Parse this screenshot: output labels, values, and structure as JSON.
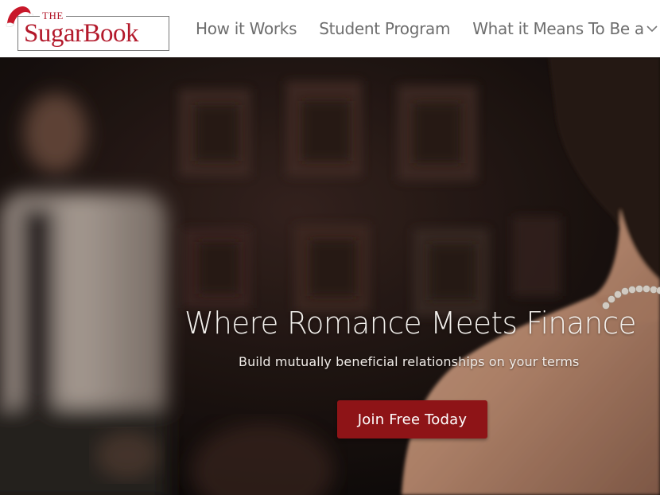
{
  "brand": {
    "logo_the": "THE",
    "logo_name": "SugarBook",
    "accent_color": "#b3192b"
  },
  "nav": {
    "items": [
      {
        "label": "How it Works"
      },
      {
        "label": "Student Program"
      },
      {
        "label": "What it Means To Be a"
      }
    ],
    "dropdown_icon": "chevron-down-icon"
  },
  "hero": {
    "headline": "Where Romance Meets Finance",
    "subheadline": "Build mutually beneficial relationships on your terms",
    "cta_label": "Join Free Today",
    "cta_color": "#8e1417"
  }
}
